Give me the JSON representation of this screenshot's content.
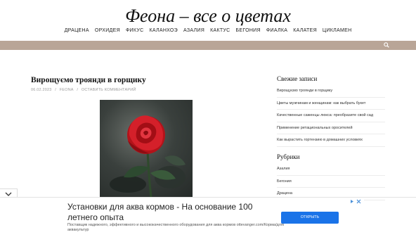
{
  "site": {
    "title": "Феона – все о цветах"
  },
  "nav": {
    "items": [
      "ДРАЦЕНА",
      "ОРХИДЕЯ",
      "ФИКУС",
      "КАЛАНХОЭ",
      "АЗАЛИЯ",
      "КАКТУС",
      "БЕГОНИЯ",
      "ФИАЛКА",
      "КАЛАТЕЯ",
      "ЦИКЛАМЕН"
    ]
  },
  "post": {
    "title": "Вирощуємо троянди в горщику",
    "date": "06.02.2023",
    "author": "FEONA",
    "comment_link": "ОСТАВИТЬ КОММЕНТАРИЙ",
    "sep": "/"
  },
  "sidebar": {
    "recent_heading": "Свежие записи",
    "recent": [
      "Вирощуємо троянди в горщику",
      "Цветы мужчинам и женщинам: как выбрать букет",
      "Качественные саженцы люкса: преобразите свой сад",
      "Применение ретациональных оросителей",
      "Как вырастить гортензию в домашних условиях"
    ],
    "categories_heading": "Рубрики",
    "categories": [
      "Азалия",
      "Бегония",
      "Драцена"
    ]
  },
  "ad": {
    "headline": "Установки для аква кормов - На основание 100 летнего опыта",
    "description": "Поставщик надежного, эффективного и высококачественного оборудования для аква кормов ottevanger.com/Корма/для/аквакультур",
    "button": "ОТКРЫТЬ"
  },
  "colors": {
    "bar": "#b9a597",
    "ad_button": "#1a73e8"
  }
}
